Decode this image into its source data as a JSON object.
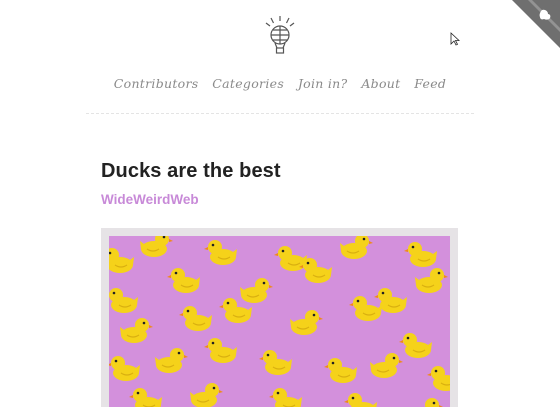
{
  "nav": {
    "items": [
      {
        "label": "Contributors"
      },
      {
        "label": "Categories"
      },
      {
        "label": "Join in?"
      },
      {
        "label": "About"
      },
      {
        "label": "Feed"
      }
    ]
  },
  "post": {
    "title": "Ducks are the best",
    "author": "WideWeirdWeb"
  },
  "colors": {
    "accent": "#c88ad8",
    "image_bg": "#d390dc",
    "duck_yellow": "#f5d21a",
    "duck_beak": "#f08a1a"
  },
  "icons": {
    "logo": "hot-air-balloon-icon",
    "corner": "github-corner-icon",
    "cursor": "mouse-pointer-icon"
  }
}
